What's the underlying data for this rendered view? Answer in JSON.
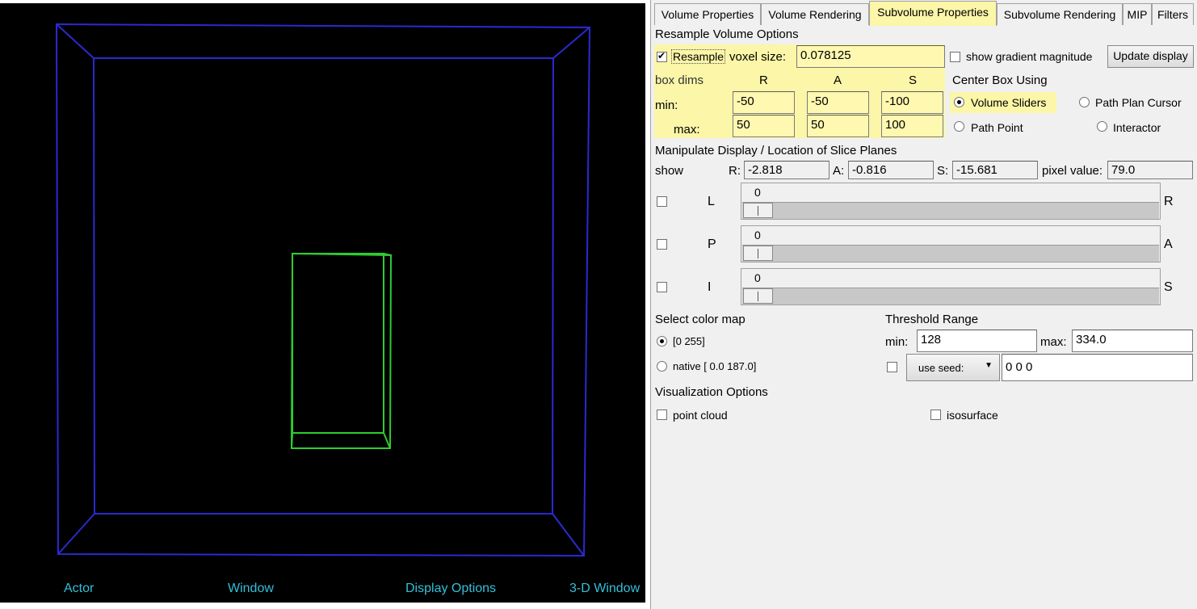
{
  "viewer": {
    "bottom_bar": [
      "Actor",
      "Window",
      "Display Options",
      "3-D Window"
    ],
    "outer_box_color": "#2a2ad0",
    "inner_box_color": "#2ecc2e"
  },
  "tabs": [
    "Volume Properties",
    "Volume Rendering",
    "Subvolume Properties",
    "Subvolume Rendering",
    "MIP",
    "Filters"
  ],
  "active_tab": "Subvolume Properties",
  "resample": {
    "section_title": "Resample Volume Options",
    "resample_label": "Resample",
    "resample_checked": true,
    "voxel_label": "voxel size:",
    "voxel_value": "0.078125",
    "show_gradient_label": "show gradient magnitude",
    "update_button": "Update display",
    "box_dims_label": "box dims",
    "col_r": "R",
    "col_a": "A",
    "col_s": "S",
    "min_label": "min:",
    "max_label": "max:",
    "min_r": "-50",
    "min_a": "-50",
    "min_s": "-100",
    "max_r": "50",
    "max_a": "50",
    "max_s": "100",
    "center_title": "Center Box Using",
    "opt_volume_sliders": "Volume Sliders",
    "opt_path_plan": "Path Plan Cursor",
    "opt_path_point": "Path Point",
    "opt_interactor": "Interactor"
  },
  "manipulate": {
    "section_title": "Manipulate Display / Location of Slice Planes",
    "show_label": "show",
    "r_label": "R:",
    "r_value": "-2.818",
    "a_label": "A:",
    "a_value": "-0.816",
    "s_label": "S:",
    "s_value": "-15.681",
    "pixel_label": "pixel value:",
    "pixel_value": "79.0",
    "sliders": [
      {
        "left": "L",
        "right": "R",
        "value": "0"
      },
      {
        "left": "P",
        "right": "A",
        "value": "0"
      },
      {
        "left": "I",
        "right": "S",
        "value": "0"
      }
    ]
  },
  "colormap": {
    "title": "Select color map",
    "opt1": "[0 255]",
    "opt2": "native [ 0.0 187.0]"
  },
  "threshold": {
    "title": "Threshold Range",
    "min_label": "min:",
    "min_value": "128",
    "max_label": "max:",
    "max_value": "334.0",
    "seed_button": "use seed:",
    "seed_value": "0 0 0"
  },
  "visualization": {
    "title": "Visualization Options",
    "point_cloud": "point cloud",
    "isosurface": "isosurface"
  }
}
